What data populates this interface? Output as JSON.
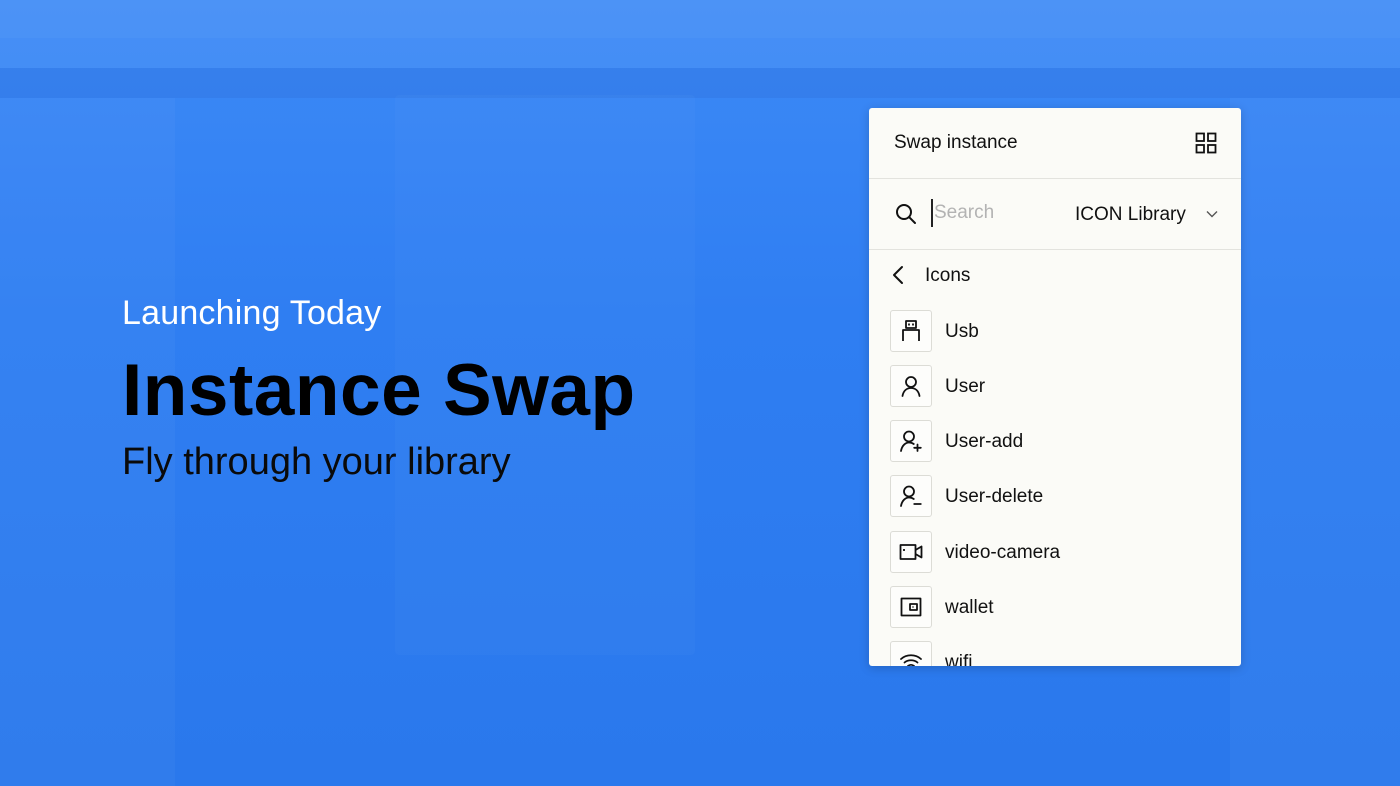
{
  "hero": {
    "eyebrow": "Launching Today",
    "title": "Instance Swap",
    "subtitle": "Fly through your library"
  },
  "panel": {
    "title": "Swap instance",
    "grid_icon": "grid-icon",
    "search": {
      "value": "",
      "placeholder": "Search",
      "icon": "search-icon"
    },
    "library": {
      "selected": "ICON Library",
      "icon": "chevron-down-icon"
    },
    "back": {
      "label": "Icons",
      "icon": "chevron-left-icon"
    },
    "items": [
      {
        "label": "Usb",
        "icon": "usb-icon"
      },
      {
        "label": "User",
        "icon": "user-icon"
      },
      {
        "label": "User-add",
        "icon": "user-add-icon"
      },
      {
        "label": "User-delete",
        "icon": "user-delete-icon"
      },
      {
        "label": "video-camera",
        "icon": "video-camera-icon"
      },
      {
        "label": "wallet",
        "icon": "wallet-icon"
      },
      {
        "label": "wifi",
        "icon": "wifi-icon"
      }
    ]
  },
  "colors": {
    "background": "#2f7ef2",
    "panel": "#fbfbf7",
    "title_text": "#000000",
    "eyebrow_text": "#ffffff"
  }
}
